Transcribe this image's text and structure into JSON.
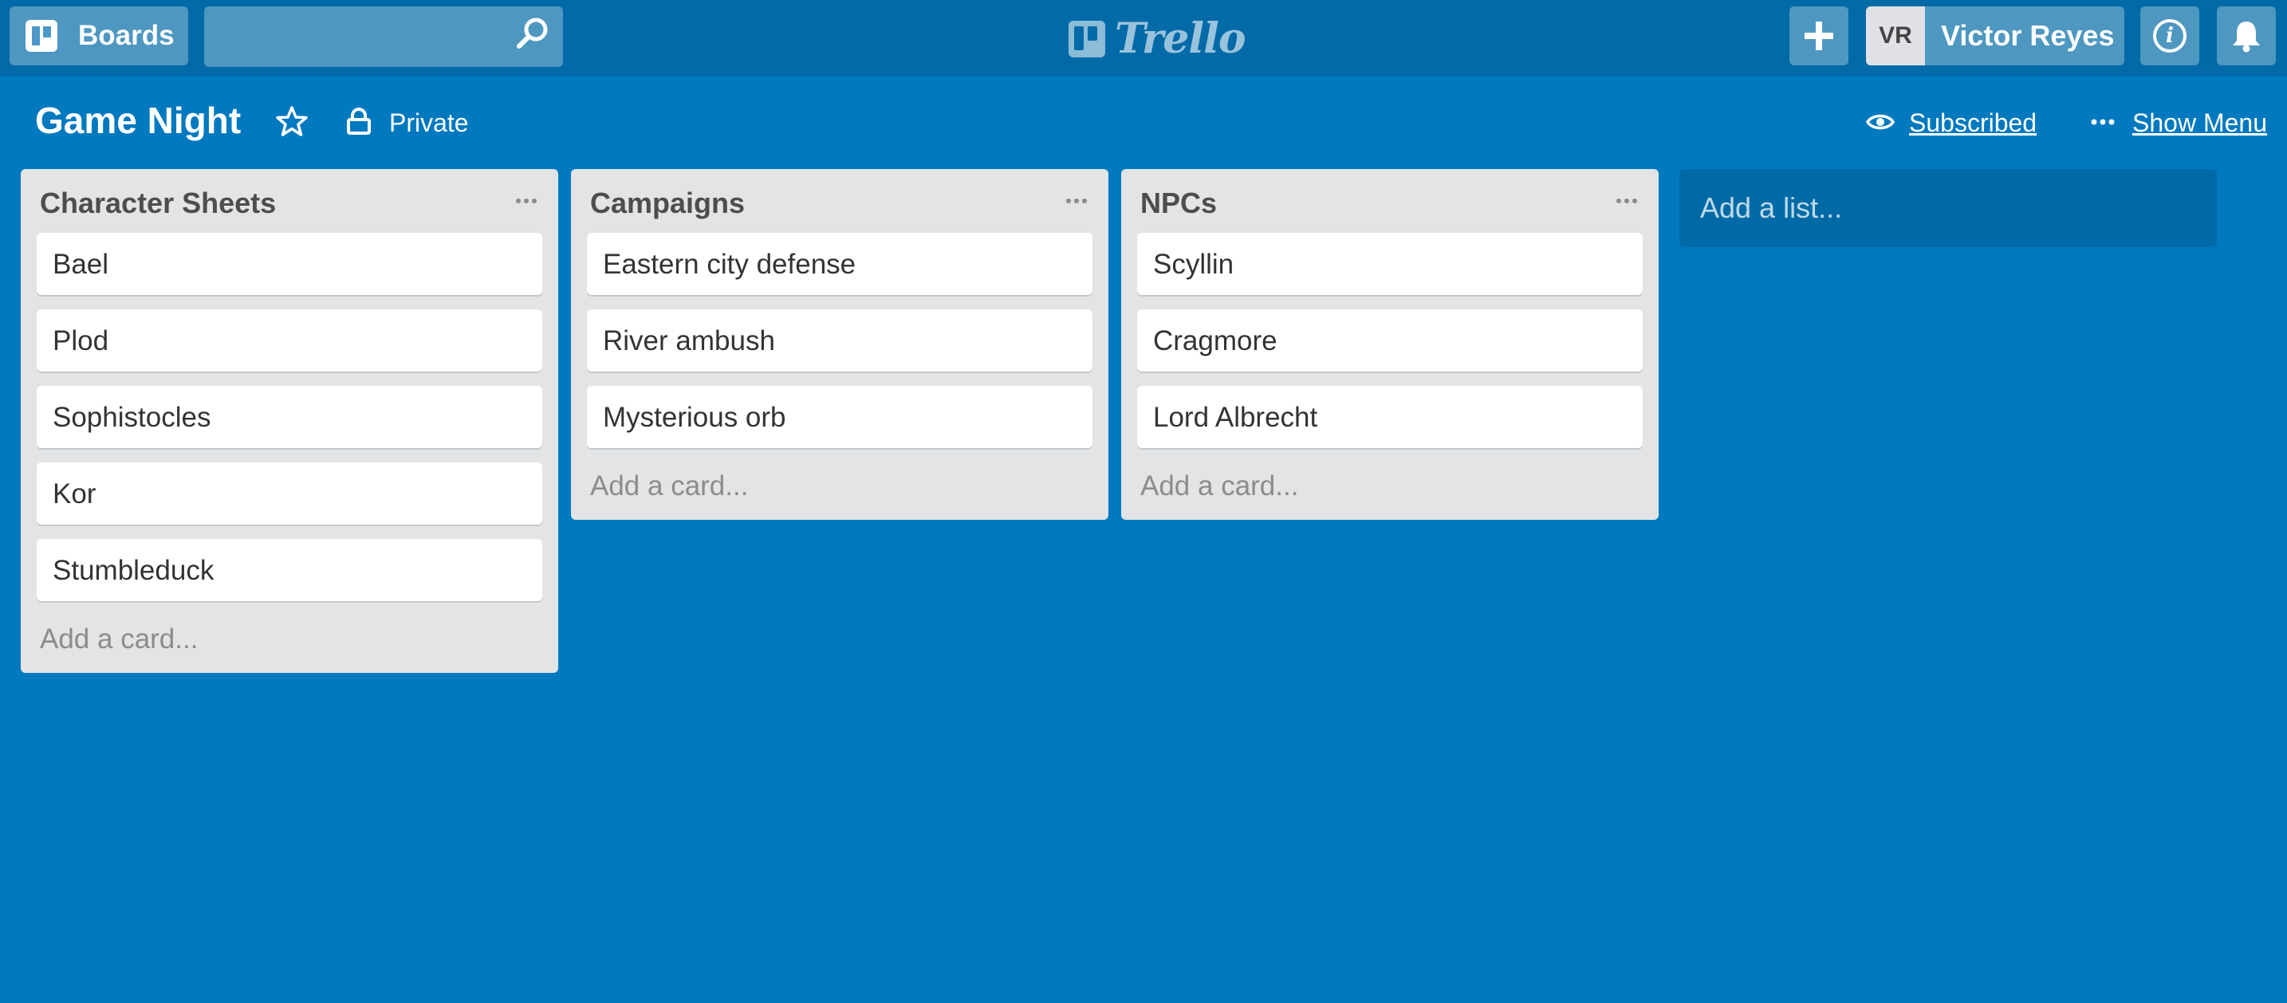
{
  "header": {
    "boards_label": "Boards",
    "search_value": "",
    "logo_text": "Trello",
    "user_initials": "VR",
    "user_name": "Victor Reyes"
  },
  "board": {
    "title": "Game Night",
    "privacy": "Private",
    "subscribed_label": "Subscribed",
    "show_menu_label": "Show Menu"
  },
  "lists": [
    {
      "title": "Character Sheets",
      "cards": [
        "Bael",
        "Plod",
        "Sophistocles",
        "Kor",
        "Stumbleduck"
      ],
      "add_card_label": "Add a card..."
    },
    {
      "title": "Campaigns",
      "cards": [
        "Eastern city defense",
        "River ambush",
        "Mysterious orb"
      ],
      "add_card_label": "Add a card..."
    },
    {
      "title": "NPCs",
      "cards": [
        "Scyllin",
        "Cragmore",
        "Lord Albrecht"
      ],
      "add_card_label": "Add a card..."
    }
  ],
  "add_list_label": "Add a list...",
  "colors": {
    "board_background": "#0079bf",
    "header_background": "#026aa7",
    "list_background": "#e2e4e6"
  }
}
